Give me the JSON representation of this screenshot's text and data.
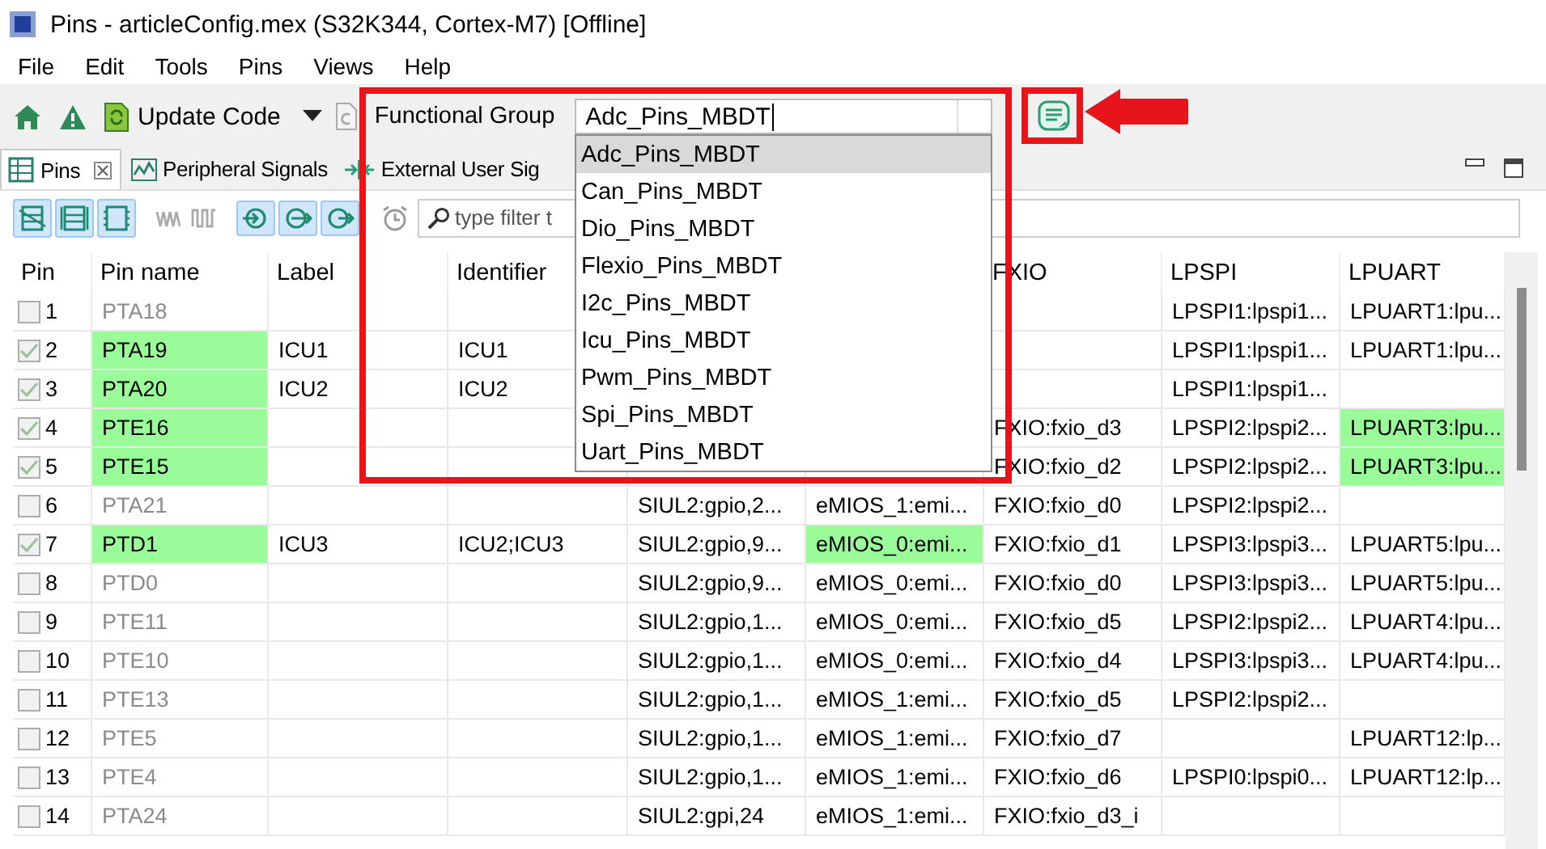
{
  "window": {
    "title": "Pins - articleConfig.mex (S32K344, Cortex-M7) [Offline]"
  },
  "menu": [
    "File",
    "Edit",
    "Tools",
    "Pins",
    "Views",
    "Help"
  ],
  "toolbar": {
    "update_button": "Update Code",
    "group_label": "Functional Group",
    "group_value": "Adc_Pins_MBDT"
  },
  "group_list": [
    {
      "label": "Adc_Pins_MBDT",
      "selected": true
    },
    {
      "label": "Can_Pins_MBDT",
      "selected": false
    },
    {
      "label": "Dio_Pins_MBDT",
      "selected": false
    },
    {
      "label": "Flexio_Pins_MBDT",
      "selected": false
    },
    {
      "label": "I2c_Pins_MBDT",
      "selected": false
    },
    {
      "label": "Icu_Pins_MBDT",
      "selected": false
    },
    {
      "label": "Pwm_Pins_MBDT",
      "selected": false
    },
    {
      "label": "Spi_Pins_MBDT",
      "selected": false
    },
    {
      "label": "Uart_Pins_MBDT",
      "selected": false
    }
  ],
  "tabs": [
    {
      "label": "Pins",
      "selected": true
    },
    {
      "label": "Peripheral Signals",
      "selected": false
    },
    {
      "label": "External User Sig",
      "selected": false
    }
  ],
  "filter": {
    "placeholder": "type filter t"
  },
  "table": {
    "columns": [
      {
        "heading": "Pin"
      },
      {
        "heading": "Pin name"
      },
      {
        "heading": "Label"
      },
      {
        "heading": "Identifier"
      },
      {},
      {},
      {
        "heading": "FXIO"
      },
      {
        "heading": "LPSPI"
      },
      {
        "heading": "LPUART"
      }
    ],
    "rows": [
      {
        "checked": false,
        "cells": [
          {
            "text": "1",
            "highlighted": false
          },
          {
            "text": "PTA18",
            "highlighted": false
          },
          {
            "text": "",
            "highlighted": false
          },
          {
            "text": "",
            "highlighted": false
          },
          null,
          null,
          {
            "text": "",
            "highlighted": false
          },
          {
            "text": "LPSPI1:lpspi1...",
            "highlighted": false
          },
          {
            "text": "LPUART1:lpu...",
            "highlighted": false
          }
        ]
      },
      {
        "checked": true,
        "cells": [
          {
            "text": "2",
            "highlighted": false
          },
          {
            "text": "PTA19",
            "highlighted": true
          },
          {
            "text": "ICU1",
            "highlighted": false
          },
          {
            "text": "ICU1",
            "highlighted": false
          },
          null,
          null,
          {
            "text": "",
            "highlighted": false
          },
          {
            "text": "LPSPI1:lpspi1...",
            "highlighted": false
          },
          {
            "text": "LPUART1:lpu...",
            "highlighted": false
          }
        ]
      },
      {
        "checked": true,
        "cells": [
          {
            "text": "3",
            "highlighted": false
          },
          {
            "text": "PTA20",
            "highlighted": true
          },
          {
            "text": "ICU2",
            "highlighted": false
          },
          {
            "text": "ICU2",
            "highlighted": false
          },
          null,
          null,
          {
            "text": "",
            "highlighted": false
          },
          {
            "text": "LPSPI1:lpspi1...",
            "highlighted": false
          },
          {
            "text": "",
            "highlighted": false
          }
        ]
      },
      {
        "checked": true,
        "cells": [
          {
            "text": "4",
            "highlighted": false
          },
          {
            "text": "PTE16",
            "highlighted": true
          },
          {
            "text": "",
            "highlighted": false
          },
          {
            "text": "",
            "highlighted": false
          },
          null,
          null,
          {
            "text": "FXIO:fxio_d3",
            "highlighted": false
          },
          {
            "text": "LPSPI2:lpspi2...",
            "highlighted": false
          },
          {
            "text": "LPUART3:lpu...",
            "highlighted": true
          }
        ]
      },
      {
        "checked": true,
        "cells": [
          {
            "text": "5",
            "highlighted": false
          },
          {
            "text": "PTE15",
            "highlighted": true
          },
          {
            "text": "",
            "highlighted": false
          },
          {
            "text": "",
            "highlighted": false
          },
          {
            "text": "",
            "highlighted": false
          },
          {
            "text": "",
            "highlighted": false
          },
          {
            "text": "FXIO:fxio_d2",
            "highlighted": false
          },
          {
            "text": "LPSPI2:lpspi2...",
            "highlighted": false
          },
          {
            "text": "LPUART3:lpu...",
            "highlighted": true
          }
        ]
      },
      {
        "checked": false,
        "cells": [
          {
            "text": "6",
            "highlighted": false
          },
          {
            "text": "PTA21",
            "highlighted": false
          },
          {
            "text": "",
            "highlighted": false
          },
          {
            "text": "",
            "highlighted": false
          },
          {
            "text": "SIUL2:gpio,2...",
            "highlighted": false
          },
          {
            "text": "eMIOS_1:emi...",
            "highlighted": false
          },
          {
            "text": "FXIO:fxio_d0",
            "highlighted": false
          },
          {
            "text": "LPSPI2:lpspi2...",
            "highlighted": false
          },
          {
            "text": "",
            "highlighted": false
          }
        ]
      },
      {
        "checked": true,
        "cells": [
          {
            "text": "7",
            "highlighted": false
          },
          {
            "text": "PTD1",
            "highlighted": true
          },
          {
            "text": "ICU3",
            "highlighted": false
          },
          {
            "text": "ICU2;ICU3",
            "highlighted": false
          },
          {
            "text": "SIUL2:gpio,9...",
            "highlighted": false
          },
          {
            "text": "eMIOS_0:emi...",
            "highlighted": true
          },
          {
            "text": "FXIO:fxio_d1",
            "highlighted": false
          },
          {
            "text": "LPSPI3:lpspi3...",
            "highlighted": false
          },
          {
            "text": "LPUART5:lpu...",
            "highlighted": false
          }
        ]
      },
      {
        "checked": false,
        "cells": [
          {
            "text": "8",
            "highlighted": false
          },
          {
            "text": "PTD0",
            "highlighted": false
          },
          {
            "text": "",
            "highlighted": false
          },
          {
            "text": "",
            "highlighted": false
          },
          {
            "text": "SIUL2:gpio,9...",
            "highlighted": false
          },
          {
            "text": "eMIOS_0:emi...",
            "highlighted": false
          },
          {
            "text": "FXIO:fxio_d0",
            "highlighted": false
          },
          {
            "text": "LPSPI3:lpspi3...",
            "highlighted": false
          },
          {
            "text": "LPUART5:lpu...",
            "highlighted": false
          }
        ]
      },
      {
        "checked": false,
        "cells": [
          {
            "text": "9",
            "highlighted": false
          },
          {
            "text": "PTE11",
            "highlighted": false
          },
          {
            "text": "",
            "highlighted": false
          },
          {
            "text": "",
            "highlighted": false
          },
          {
            "text": "SIUL2:gpio,1...",
            "highlighted": false
          },
          {
            "text": "eMIOS_0:emi...",
            "highlighted": false
          },
          {
            "text": "FXIO:fxio_d5",
            "highlighted": false
          },
          {
            "text": "LPSPI2:lpspi2...",
            "highlighted": false
          },
          {
            "text": "LPUART4:lpu...",
            "highlighted": false
          }
        ]
      },
      {
        "checked": false,
        "cells": [
          {
            "text": "10",
            "highlighted": false
          },
          {
            "text": "PTE10",
            "highlighted": false
          },
          {
            "text": "",
            "highlighted": false
          },
          {
            "text": "",
            "highlighted": false
          },
          {
            "text": "SIUL2:gpio,1...",
            "highlighted": false
          },
          {
            "text": "eMIOS_0:emi...",
            "highlighted": false
          },
          {
            "text": "FXIO:fxio_d4",
            "highlighted": false
          },
          {
            "text": "LPSPI3:lpspi3...",
            "highlighted": false
          },
          {
            "text": "LPUART4:lpu...",
            "highlighted": false
          }
        ]
      },
      {
        "checked": false,
        "cells": [
          {
            "text": "11",
            "highlighted": false
          },
          {
            "text": "PTE13",
            "highlighted": false
          },
          {
            "text": "",
            "highlighted": false
          },
          {
            "text": "",
            "highlighted": false
          },
          {
            "text": "SIUL2:gpio,1...",
            "highlighted": false
          },
          {
            "text": "eMIOS_1:emi...",
            "highlighted": false
          },
          {
            "text": "FXIO:fxio_d5",
            "highlighted": false
          },
          {
            "text": "LPSPI2:lpspi2...",
            "highlighted": false
          },
          {
            "text": "",
            "highlighted": false
          }
        ]
      },
      {
        "checked": false,
        "cells": [
          {
            "text": "12",
            "highlighted": false
          },
          {
            "text": "PTE5",
            "highlighted": false
          },
          {
            "text": "",
            "highlighted": false
          },
          {
            "text": "",
            "highlighted": false
          },
          {
            "text": "SIUL2:gpio,1...",
            "highlighted": false
          },
          {
            "text": "eMIOS_1:emi...",
            "highlighted": false
          },
          {
            "text": "FXIO:fxio_d7",
            "highlighted": false
          },
          {
            "text": "",
            "highlighted": false
          },
          {
            "text": "LPUART12:lp...",
            "highlighted": false
          }
        ]
      },
      {
        "checked": false,
        "cells": [
          {
            "text": "13",
            "highlighted": false
          },
          {
            "text": "PTE4",
            "highlighted": false
          },
          {
            "text": "",
            "highlighted": false
          },
          {
            "text": "",
            "highlighted": false
          },
          {
            "text": "SIUL2:gpio,1...",
            "highlighted": false
          },
          {
            "text": "eMIOS_1:emi...",
            "highlighted": false
          },
          {
            "text": "FXIO:fxio_d6",
            "highlighted": false
          },
          {
            "text": "LPSPI0:lpspi0...",
            "highlighted": false
          },
          {
            "text": "LPUART12:lp...",
            "highlighted": false
          }
        ]
      },
      {
        "checked": false,
        "cells": [
          {
            "text": "14",
            "highlighted": false
          },
          {
            "text": "PTA24",
            "highlighted": false
          },
          {
            "text": "",
            "highlighted": false
          },
          {
            "text": "",
            "highlighted": false
          },
          {
            "text": "SIUL2:gpi,24",
            "highlighted": false
          },
          {
            "text": "eMIOS_1:emi...",
            "highlighted": false
          },
          {
            "text": "FXIO:fxio_d3_i",
            "highlighted": false
          },
          {
            "text": "",
            "highlighted": false
          },
          {
            "text": "",
            "highlighted": false
          }
        ]
      }
    ]
  }
}
